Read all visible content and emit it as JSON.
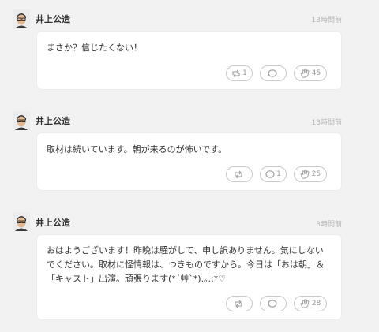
{
  "posts": [
    {
      "author": "井上公造",
      "time": "13時間前",
      "text": "まさか？信じたくない！",
      "retweets": "1",
      "comments": "",
      "claps": "45"
    },
    {
      "author": "井上公造",
      "time": "13時間前",
      "text": "取材は続いています。朝が来るのが怖いです。",
      "retweets": "",
      "comments": "1",
      "claps": "25"
    },
    {
      "author": "井上公造",
      "time": "8時間前",
      "text": "おはようございます！昨晩は騒がして、申し訳ありません。気にしないでください。取材に怪情報は、つきものですから。今日は「おは朝」＆「キャスト」出演。頑張ります(*´艸`*).｡.:*♡",
      "retweets": "",
      "comments": "",
      "claps": "28"
    }
  ],
  "icons": {
    "retweet": "retweet-icon",
    "comment": "comment-icon",
    "clap": "clap-icon"
  }
}
